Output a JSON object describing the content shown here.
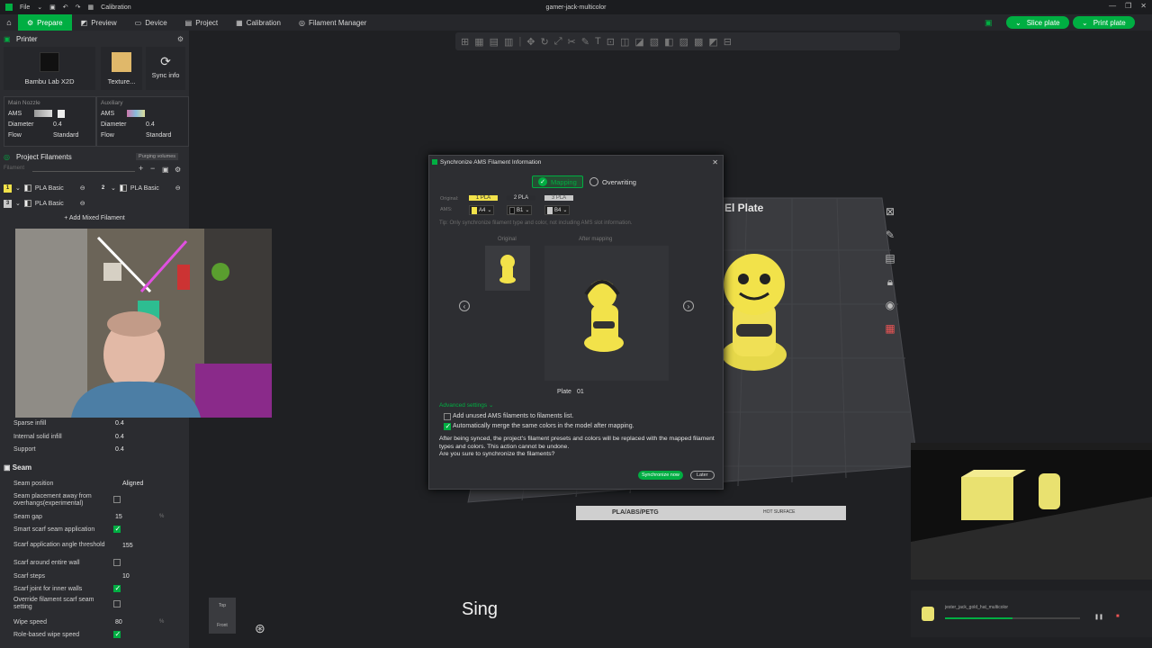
{
  "titlebar": {
    "file_menu": "File",
    "calibration": "Calibration",
    "window_title": "gamer-jack-multicolor"
  },
  "nav": {
    "prepare": "Prepare",
    "preview": "Preview",
    "device": "Device",
    "project": "Project",
    "calibration": "Calibration",
    "filament_manager": "Filament Manager",
    "slice_plate": "Slice plate",
    "print_plate": "Print plate"
  },
  "printer": {
    "section_title": "Printer",
    "printer_name": "Bambu Lab X2D",
    "plate_name": "Texture...",
    "sync_info": "Sync info",
    "main_nozzle": {
      "label": "Main Nozzle",
      "ams": "AMS",
      "diameter_label": "Diameter",
      "diameter_value": "0.4",
      "flow_label": "Flow",
      "flow_value": "Standard"
    },
    "aux_nozzle": {
      "label": "Auxiliary",
      "ams": "AMS",
      "diameter_label": "Diameter",
      "diameter_value": "0.4",
      "flow_label": "Flow",
      "flow_value": "Standard"
    }
  },
  "filaments": {
    "section_title": "Project Filaments",
    "purging_volumes": "Purging volumes",
    "filament_label": "Filament",
    "items": [
      {
        "num": "1",
        "name": "PLA Basic",
        "color": "#f2e24a"
      },
      {
        "num": "2",
        "name": "PLA Basic",
        "color": "#2b2c30"
      },
      {
        "num": "3",
        "name": "PLA Basic",
        "color": "#c8c8c8"
      }
    ],
    "add_mixed": "Add Mixed Filament"
  },
  "params": {
    "sparse_infill": {
      "label": "Sparse infill",
      "value": "0.4"
    },
    "internal_solid_infill": {
      "label": "Internal solid infill",
      "value": "0.4"
    },
    "support": {
      "label": "Support",
      "value": "0.4"
    },
    "seam_section": "Seam",
    "seam_position": {
      "label": "Seam position",
      "value": "Aligned"
    },
    "seam_away": {
      "label": "Seam placement away from overhangs(experimental)"
    },
    "seam_gap": {
      "label": "Seam gap",
      "value": "15",
      "unit": "%"
    },
    "smart_scarf": {
      "label": "Smart scarf seam application"
    },
    "scarf_angle": {
      "label": "Scarf application angle threshold",
      "value": "155"
    },
    "scarf_entire_wall": {
      "label": "Scarf around entire wall"
    },
    "scarf_steps": {
      "label": "Scarf steps",
      "value": "10"
    },
    "scarf_inner": {
      "label": "Scarf joint for inner walls"
    },
    "override_scarf": {
      "label": "Override filament scarf seam setting"
    },
    "wipe_speed": {
      "label": "Wipe speed",
      "value": "80",
      "unit": "%"
    },
    "role_based_wipe": {
      "label": "Role-based wipe speed"
    }
  },
  "dialog": {
    "title": "Synchronize AMS Filament Information",
    "tab_mapping": "Mapping",
    "tab_overwriting": "Overwriting",
    "original_label": "Original:",
    "ams_label": "AMS:",
    "slots": [
      {
        "top": "1 PLA",
        "ams": "A4"
      },
      {
        "top": "2 PLA",
        "ams": "B1"
      },
      {
        "top": "3 PLA",
        "ams": "B4"
      }
    ],
    "tip": "Tip: Only synchronize filament type and color, not including AMS slot information.",
    "original_caption": "Original",
    "after_caption": "After mapping",
    "plate_label": "Plate",
    "plate_value": "01",
    "advanced": "Advanced settings",
    "opt_unused": "Add unused AMS filaments to filaments list.",
    "opt_merge": "Automatically merge the same colors in the model after mapping.",
    "warning": "After being synced, the project's filament presets and colors will be replaced with the mapped filament types and colors. This action cannot be undone.",
    "question": "Are you sure to synchronize the filaments?",
    "sync_now": "Synchronize now",
    "later": "Later"
  },
  "scene": {
    "plate_label": "El Plate",
    "plate_strip": "PLA/ABS/PETG",
    "hot_surface": "HOT SURFACE",
    "view_top": "Top",
    "view_front": "Front",
    "caption": "Sing"
  },
  "status": {
    "job": "jester_jack_gold_hat_multicolor"
  }
}
